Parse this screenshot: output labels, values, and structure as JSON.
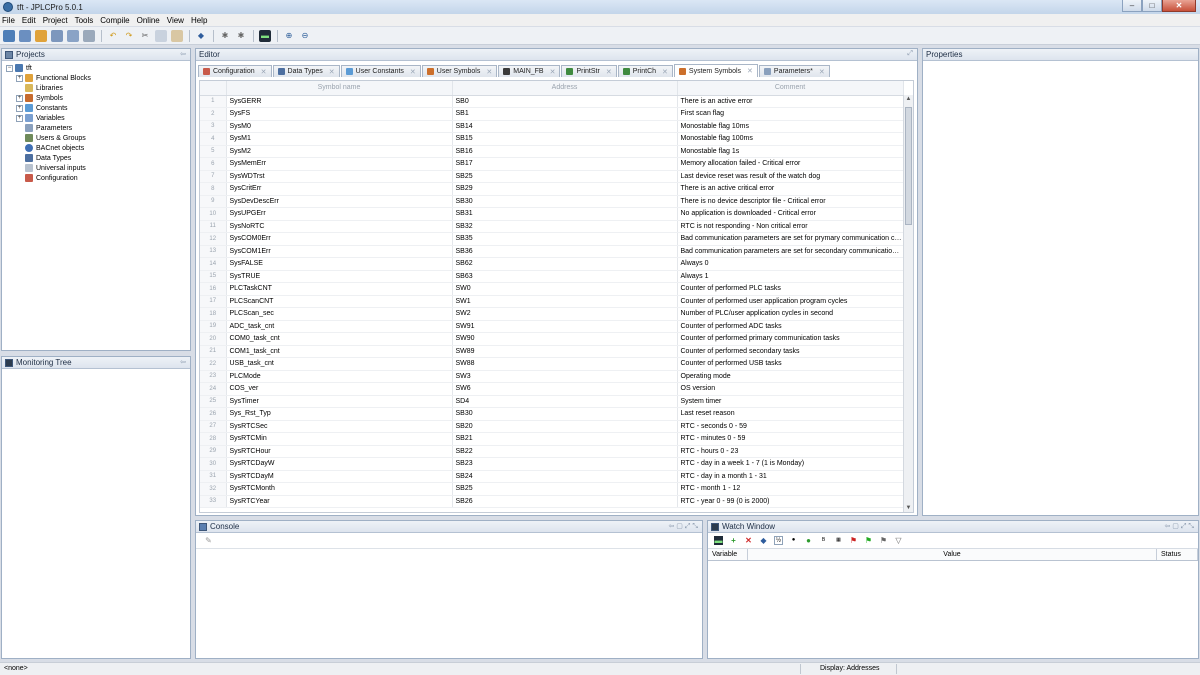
{
  "window": {
    "title": "tft - JPLCPro 5.0.1",
    "minimize": "–",
    "maximize": "□",
    "close": "✕"
  },
  "menu": [
    "File",
    "Edit",
    "Project",
    "Tools",
    "Compile",
    "Online",
    "View",
    "Help"
  ],
  "toolbar_icons": [
    "new-project-icon",
    "open-icon",
    "folder-icon",
    "save-icon",
    "save-all-icon",
    "print-icon",
    "undo-icon",
    "redo-icon",
    "cut-icon",
    "copy-icon",
    "paste-icon",
    "compile-icon",
    "settings-icon",
    "download-icon",
    "monitor-icon",
    "zoom-in-icon",
    "zoom-out-icon"
  ],
  "projects": {
    "title": "Projects",
    "tree": [
      {
        "label": "tft",
        "expanded": true,
        "level": 0
      },
      {
        "label": "Functional Blocks",
        "expandable": true,
        "level": 1
      },
      {
        "label": "Libraries",
        "expandable": false,
        "level": 1
      },
      {
        "label": "Symbols",
        "expandable": true,
        "level": 1
      },
      {
        "label": "Constants",
        "expandable": true,
        "level": 1
      },
      {
        "label": "Variables",
        "expandable": true,
        "level": 1
      },
      {
        "label": "Parameters",
        "expandable": false,
        "level": 1
      },
      {
        "label": "Users & Groups",
        "expandable": false,
        "level": 1
      },
      {
        "label": "BACnet objects",
        "expandable": false,
        "level": 1
      },
      {
        "label": "Data Types",
        "expandable": false,
        "level": 1
      },
      {
        "label": "Universal inputs",
        "expandable": false,
        "level": 1
      },
      {
        "label": "Configuration",
        "expandable": false,
        "level": 1
      }
    ]
  },
  "monitoring": {
    "title": "Monitoring Tree"
  },
  "editor": {
    "title": "Editor",
    "tabs": [
      {
        "label": "Configuration",
        "active": false
      },
      {
        "label": "Data Types",
        "active": false
      },
      {
        "label": "User Constants",
        "active": false
      },
      {
        "label": "User Symbols",
        "active": false
      },
      {
        "label": "MAIN_FB",
        "active": false
      },
      {
        "label": "PrintStr",
        "active": false
      },
      {
        "label": "PrintCh",
        "active": false
      },
      {
        "label": "System Symbols",
        "active": true
      },
      {
        "label": "Parameters*",
        "active": false
      }
    ],
    "columns": [
      "Symbol name",
      "Address",
      "Comment"
    ],
    "rows": [
      [
        "1",
        "SysGERR",
        "SB0",
        "There is an active error"
      ],
      [
        "2",
        "SysFS",
        "SB1",
        "First scan flag"
      ],
      [
        "3",
        "SysM0",
        "SB14",
        "Monostable flag 10ms"
      ],
      [
        "4",
        "SysM1",
        "SB15",
        "Monostable flag 100ms"
      ],
      [
        "5",
        "SysM2",
        "SB16",
        "Monostable flag 1s"
      ],
      [
        "6",
        "SysMemErr",
        "SB17",
        "Memory allocation failed - Critical error"
      ],
      [
        "7",
        "SysWDTrst",
        "SB25",
        "Last device reset was result of the watch dog"
      ],
      [
        "8",
        "SysCritErr",
        "SB29",
        "There is an active critical error"
      ],
      [
        "9",
        "SysDevDescErr",
        "SB30",
        "There is no device descriptor file - Critical error"
      ],
      [
        "10",
        "SysUPGErr",
        "SB31",
        "No application is downloaded - Critical error"
      ],
      [
        "11",
        "SysNoRTC",
        "SB32",
        "RTC is not responding - Non critical error"
      ],
      [
        "12",
        "SysCOM0Err",
        "SB35",
        "Bad communication parameters are set for prymary communication chan..."
      ],
      [
        "13",
        "SysCOM1Err",
        "SB36",
        "Bad communication parameters are set for secondary communication ch..."
      ],
      [
        "14",
        "SysFALSE",
        "SB62",
        "Always 0"
      ],
      [
        "15",
        "SysTRUE",
        "SB63",
        "Always 1"
      ],
      [
        "16",
        "PLCTaskCNT",
        "SW0",
        "Counter of performed PLC tasks"
      ],
      [
        "17",
        "PLCScanCNT",
        "SW1",
        "Counter of performed user application program cycles"
      ],
      [
        "18",
        "PLCScan_sec",
        "SW2",
        "Number of PLC/user application cycles in second"
      ],
      [
        "19",
        "ADC_task_cnt",
        "SW91",
        "Counter of performed ADC tasks"
      ],
      [
        "20",
        "COM0_task_cnt",
        "SW90",
        "Counter of performed primary communication tasks"
      ],
      [
        "21",
        "COM1_task_cnt",
        "SW89",
        "Counter of performed secondary tasks"
      ],
      [
        "22",
        "USB_task_cnt",
        "SW88",
        "Counter of performed USB tasks"
      ],
      [
        "23",
        "PLCMode",
        "SW3",
        "Operating mode"
      ],
      [
        "24",
        "COS_ver",
        "SW6",
        "OS version"
      ],
      [
        "25",
        "SysTimer",
        "SD4",
        "System timer"
      ],
      [
        "26",
        "Sys_Rst_Typ",
        "SB30",
        "Last reset reason"
      ],
      [
        "27",
        "SysRTCSec",
        "SB20",
        "RTC - seconds 0 - 59"
      ],
      [
        "28",
        "SysRTCMin",
        "SB21",
        "RTC - minutes 0 - 59"
      ],
      [
        "29",
        "SysRTCHour",
        "SB22",
        "RTC - hours 0 - 23"
      ],
      [
        "30",
        "SysRTCDayW",
        "SB23",
        "RTC - day in a week 1 - 7 (1 is Monday)"
      ],
      [
        "31",
        "SysRTCDayM",
        "SB24",
        "RTC - day in a  month 1 - 31"
      ],
      [
        "32",
        "SysRTCMonth",
        "SB25",
        "RTC - month 1 - 12"
      ],
      [
        "33",
        "SysRTCYear",
        "SB26",
        "RTC - year 0 - 99 (0 is 2000)"
      ]
    ]
  },
  "properties": {
    "title": "Properties"
  },
  "console": {
    "title": "Console"
  },
  "watch": {
    "title": "Watch Window",
    "columns": [
      "Variable",
      "Value",
      "Status"
    ]
  },
  "status": {
    "left": "<none>",
    "display": "Display: Addresses"
  }
}
